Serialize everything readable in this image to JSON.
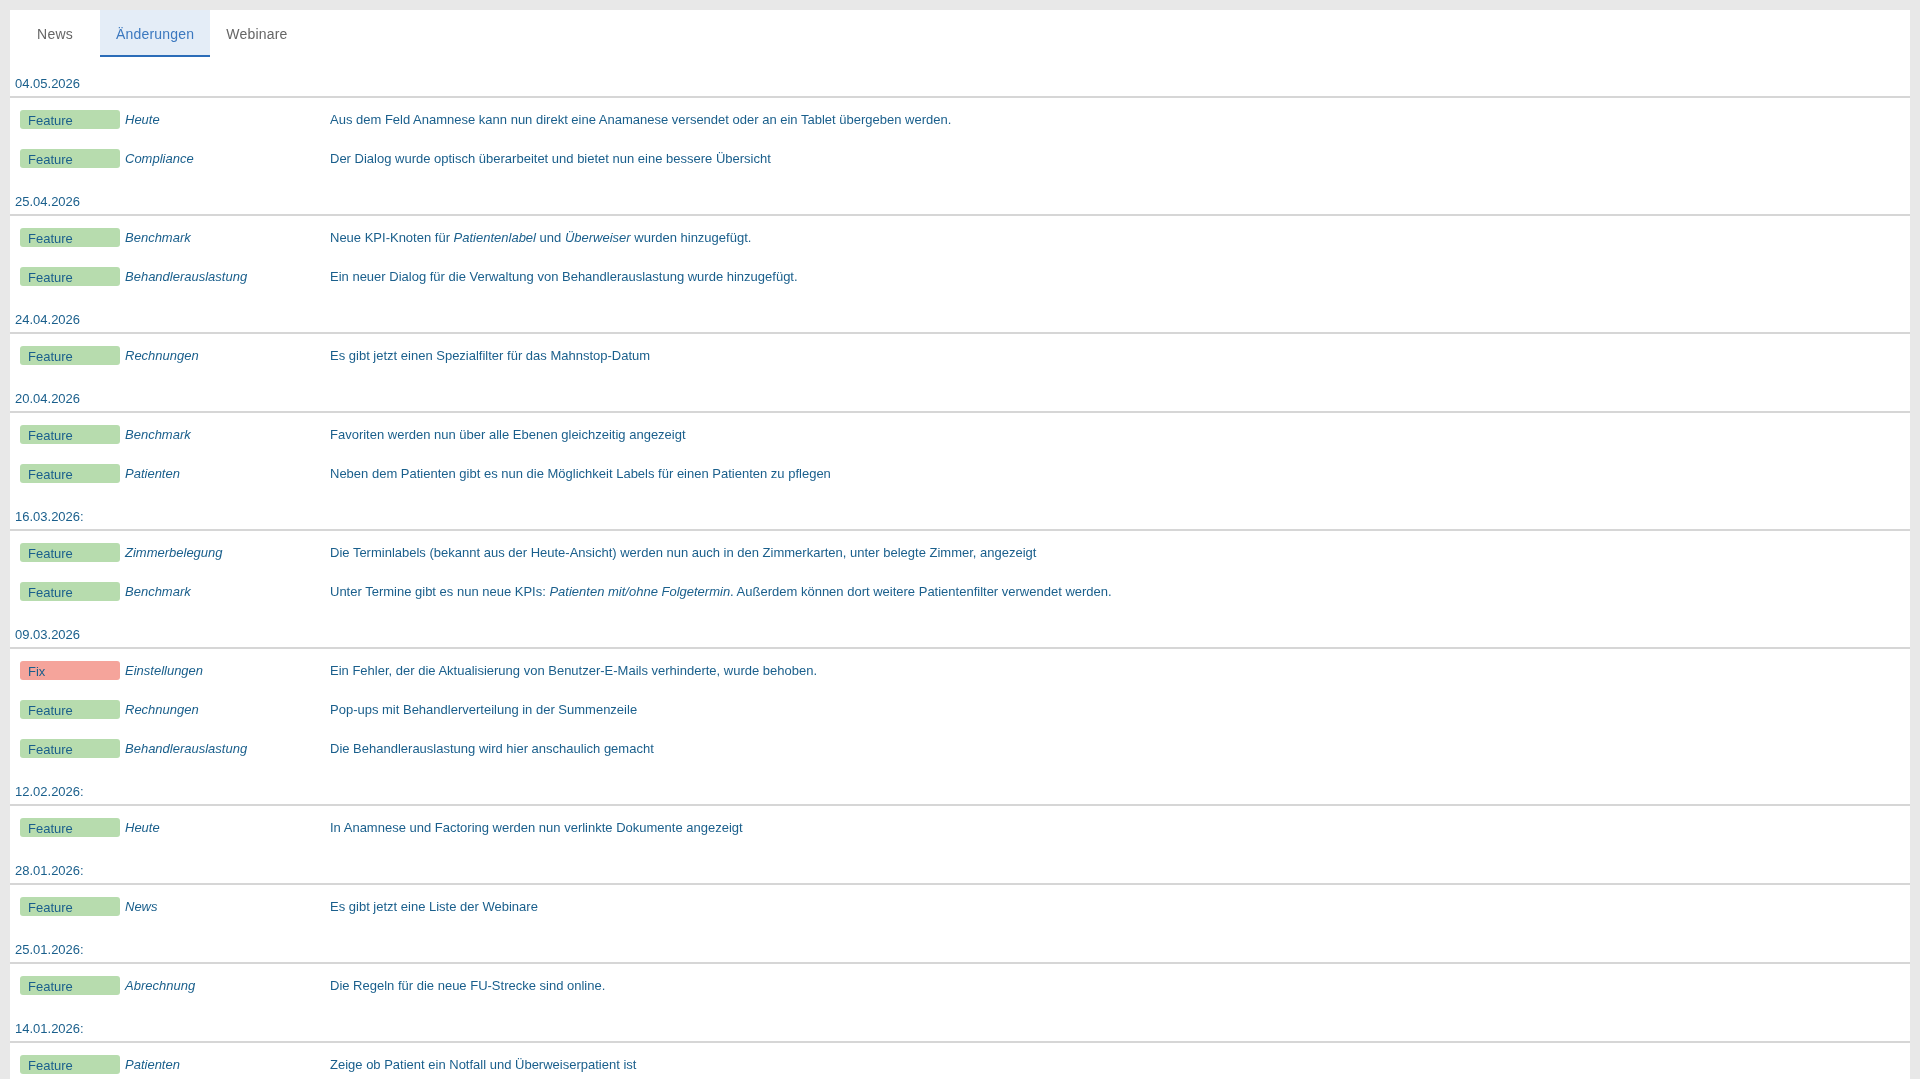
{
  "tabs": [
    {
      "label": "News",
      "selected": false
    },
    {
      "label": "Änderungen",
      "selected": true
    },
    {
      "label": "Webinare",
      "selected": false
    }
  ],
  "changelog": [
    {
      "date": "04.05.2026",
      "entries": [
        {
          "tag": {
            "label": "Feature",
            "color": "#b7dcae"
          },
          "area": "Heute",
          "description": "Aus dem Feld Anamnese kann nun direkt eine Anamanese versendet oder an ein Tablet übergeben werden."
        },
        {
          "tag": {
            "label": "Feature",
            "color": "#b7dcae"
          },
          "area": "Compliance",
          "description": "Der Dialog wurde optisch überarbeitet und bietet nun eine bessere Übersicht"
        }
      ]
    },
    {
      "date": "25.04.2026",
      "entries": [
        {
          "tag": {
            "label": "Feature",
            "color": "#b7dcae"
          },
          "area": "Benchmark",
          "description": "Neue KPI-Knoten für *Patientenlabel* und *Überweiser* wurden hinzugefügt."
        },
        {
          "tag": {
            "label": "Feature",
            "color": "#b7dcae"
          },
          "area": "Behandlerauslastung",
          "description": "Ein neuer Dialog für die Verwaltung von Behandlerauslastung wurde hinzugefügt."
        }
      ]
    },
    {
      "date": "24.04.2026",
      "entries": [
        {
          "tag": {
            "label": "Feature",
            "color": "#b7dcae"
          },
          "area": "Rechnungen",
          "description": "Es gibt jetzt einen Spezialfilter für das Mahnstop-Datum"
        }
      ]
    },
    {
      "date": "20.04.2026",
      "entries": [
        {
          "tag": {
            "label": "Feature",
            "color": "#b7dcae"
          },
          "area": "Benchmark",
          "description": "Favoriten werden nun über alle Ebenen gleichzeitig angezeigt"
        },
        {
          "tag": {
            "label": "Feature",
            "color": "#b7dcae"
          },
          "area": "Patienten",
          "description": "Neben dem Patienten gibt es nun die Möglichkeit Labels für einen Patienten zu pflegen"
        }
      ]
    },
    {
      "date": "16.03.2026:",
      "entries": [
        {
          "tag": {
            "label": "Feature",
            "color": "#b7dcae"
          },
          "area": "Zimmerbelegung",
          "description": "Die Terminlabels (bekannt aus der Heute-Ansicht) werden nun auch in den Zimmerkarten, unter belegte Zimmer, angezeigt"
        },
        {
          "tag": {
            "label": "Feature",
            "color": "#b7dcae"
          },
          "area": "Benchmark",
          "description": "Unter Termine gibt es nun neue KPIs: *Patienten mit/ohne Folgetermin*. Außerdem können dort weitere Patientenfilter verwendet werden."
        }
      ]
    },
    {
      "date": "09.03.2026",
      "entries": [
        {
          "tag": {
            "label": "Fix",
            "color": "#f5a49b"
          },
          "area": "Einstellungen",
          "description": "Ein Fehler, der die Aktualisierung von Benutzer-E-Mails verhinderte, wurde behoben."
        },
        {
          "tag": {
            "label": "Feature",
            "color": "#b7dcae"
          },
          "area": "Rechnungen",
          "description": "Pop-ups mit Behandlerverteilung in der Summenzeile"
        },
        {
          "tag": {
            "label": "Feature",
            "color": "#b7dcae"
          },
          "area": "Behandlerauslastung",
          "description": "Die Behandlerauslastung wird hier anschaulich gemacht"
        }
      ]
    },
    {
      "date": "12.02.2026:",
      "entries": [
        {
          "tag": {
            "label": "Feature",
            "color": "#b7dcae"
          },
          "area": "Heute",
          "description": "In Anamnese und Factoring werden nun verlinkte Dokumente angezeigt"
        }
      ]
    },
    {
      "date": "28.01.2026:",
      "entries": [
        {
          "tag": {
            "label": "Feature",
            "color": "#b7dcae"
          },
          "area": "News",
          "description": "Es gibt jetzt eine Liste der Webinare"
        }
      ]
    },
    {
      "date": "25.01.2026:",
      "entries": [
        {
          "tag": {
            "label": "Feature",
            "color": "#b7dcae"
          },
          "area": "Abrechnung",
          "description": "Die Regeln für die neue FU-Strecke sind online."
        }
      ]
    },
    {
      "date": "14.01.2026:",
      "entries": [
        {
          "tag": {
            "label": "Feature",
            "color": "#b7dcae"
          },
          "area": "Patienten",
          "description": "Zeige ob Patient ein Notfall und Überweiserpatient ist"
        }
      ]
    }
  ]
}
